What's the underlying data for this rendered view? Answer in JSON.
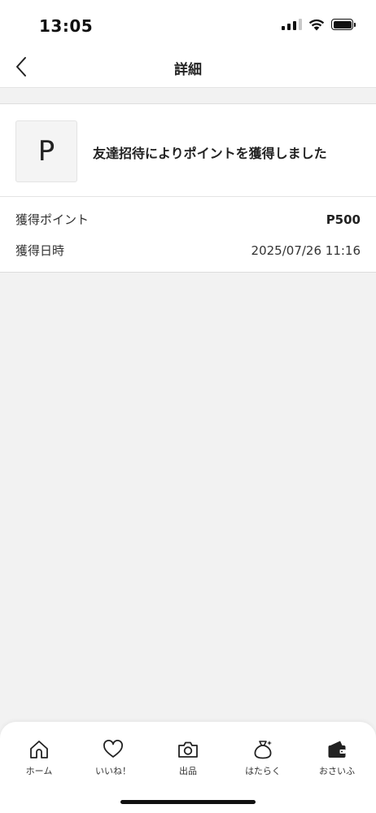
{
  "status_bar": {
    "time": "13:05",
    "icons": [
      "signal-icon",
      "wifi-icon",
      "battery-icon"
    ]
  },
  "nav": {
    "title": "詳細",
    "back_icon": "chevron-left-icon"
  },
  "notice": {
    "avatar_letter": "P",
    "message": "友達招待によりポイントを獲得しました"
  },
  "details": [
    {
      "label": "獲得ポイント",
      "value": "P500"
    },
    {
      "label": "獲得日時",
      "value": "2025/07/26 11:16"
    }
  ],
  "tab_bar": {
    "items": [
      {
        "label": "ホーム",
        "icon": "home-icon"
      },
      {
        "label": "いいね！",
        "icon": "heart-icon"
      },
      {
        "label": "出品",
        "icon": "camera-icon"
      },
      {
        "label": "はたらく",
        "icon": "money-bag-icon"
      },
      {
        "label": "おさいふ",
        "icon": "wallet-icon"
      }
    ]
  },
  "colors": {
    "background": "#f2f2f2",
    "surface": "#ffffff",
    "text": "#222222",
    "divider": "#e4e4e4"
  }
}
